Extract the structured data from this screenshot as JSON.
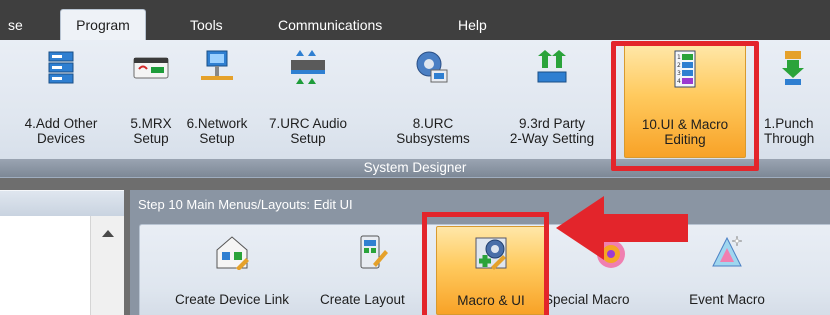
{
  "menubar": {
    "items": [
      "se",
      "Program",
      "Tools",
      "Communications",
      "Help"
    ]
  },
  "ribbon": {
    "group_title": "System Designer",
    "buttons": [
      {
        "label": "4.Add Other\nDevices"
      },
      {
        "label": "5.MRX\nSetup"
      },
      {
        "label": "6.Network\nSetup"
      },
      {
        "label": "7.URC Audio\nSetup"
      },
      {
        "label": "8.URC\nSubsystems"
      },
      {
        "label": "9.3rd Party\n2-Way Setting"
      },
      {
        "label": "10.UI & Macro\nEditing"
      },
      {
        "label": "1.Punch\nThrough"
      }
    ]
  },
  "step": {
    "title": "Step 10 Main Menus/Layouts: Edit UI",
    "buttons": [
      {
        "label": "Create Device Link"
      },
      {
        "label": "Create Layout"
      },
      {
        "label": "Macro & UI"
      },
      {
        "label": "Special Macro"
      },
      {
        "label": "Event Macro"
      }
    ]
  },
  "colors": {
    "highlight": "#e3252b",
    "selected": "#ffca5e",
    "menubar": "#3f3f3f"
  }
}
